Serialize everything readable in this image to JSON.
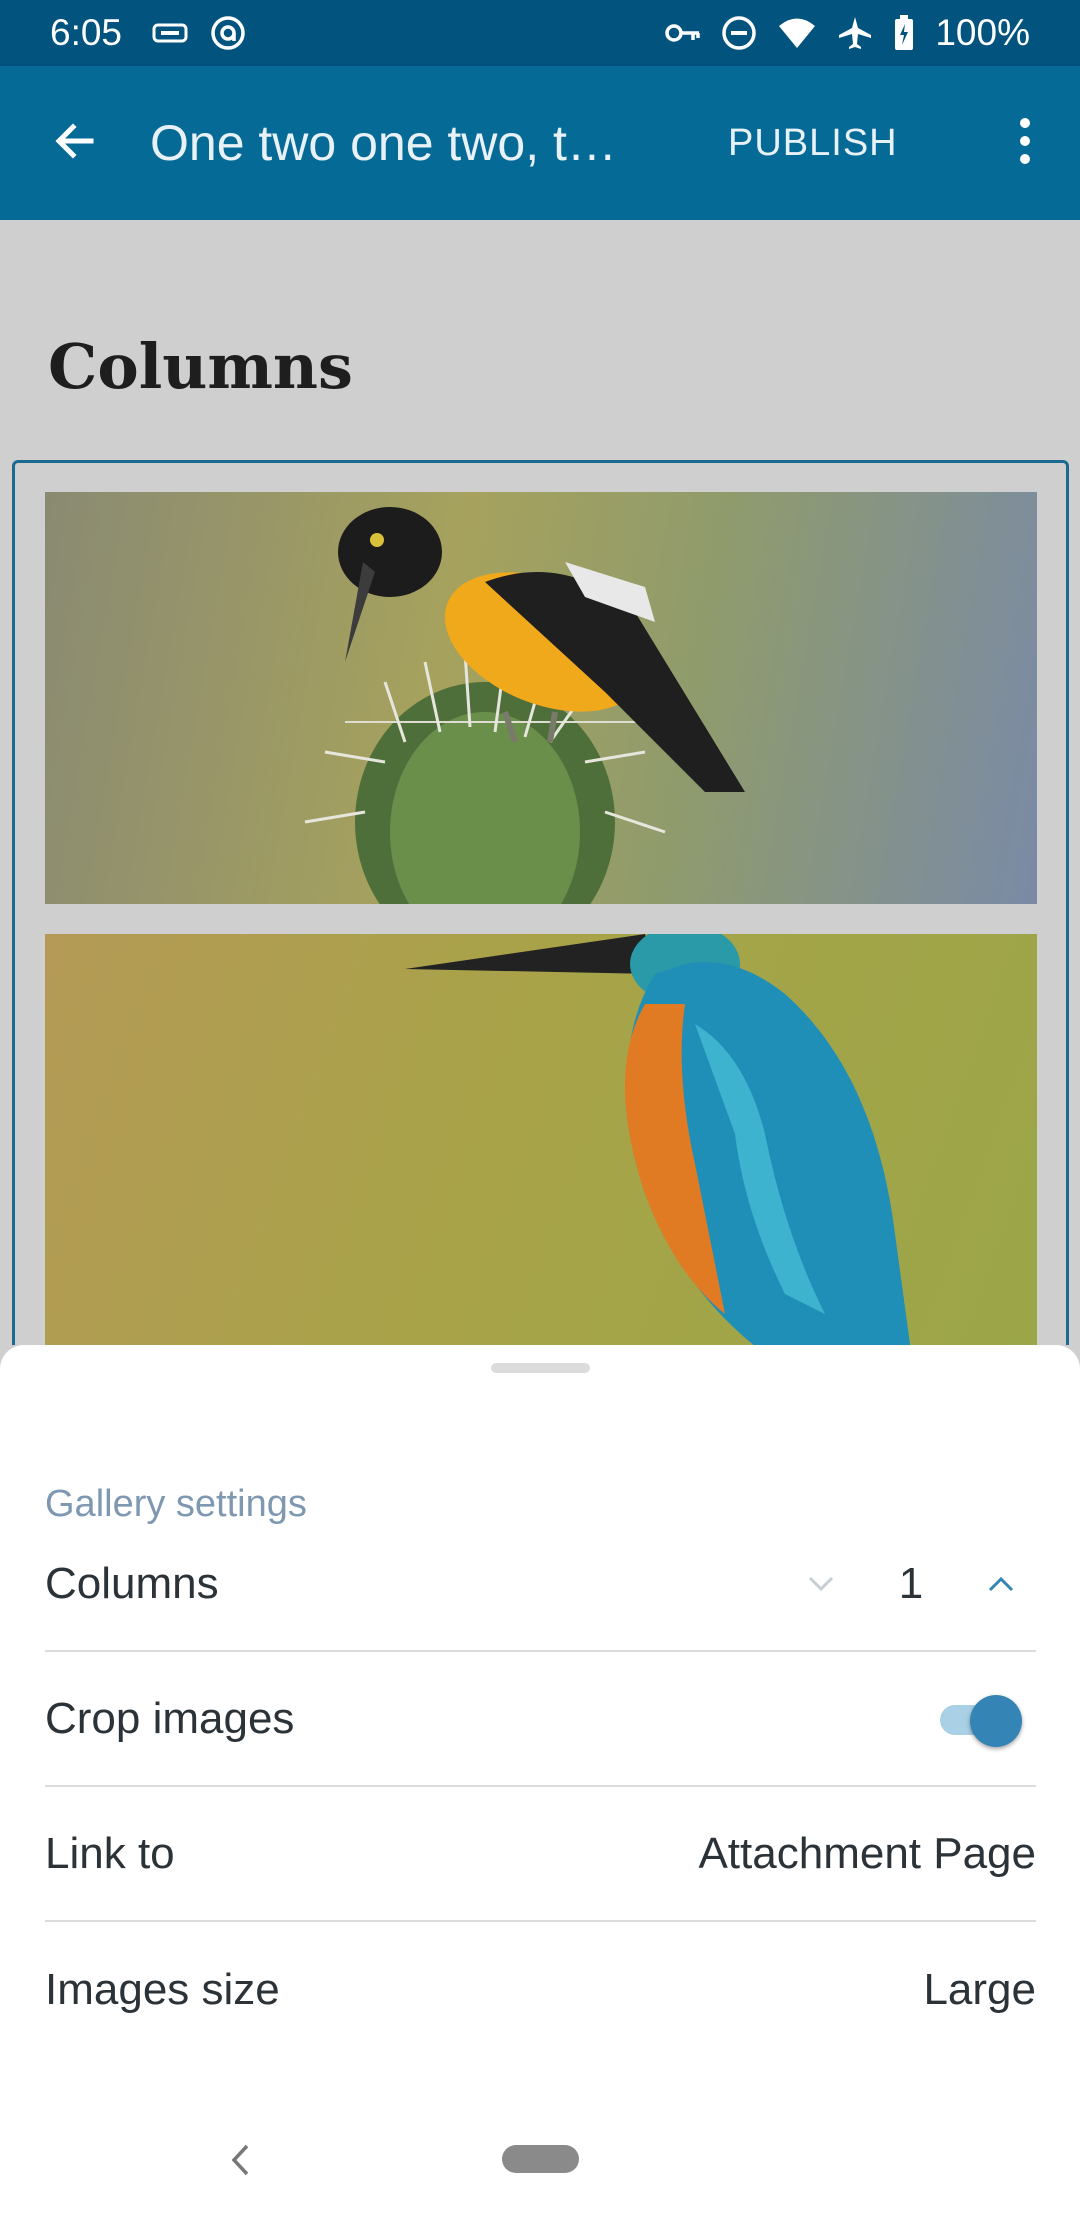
{
  "status_bar": {
    "time": "6:05",
    "battery": "100%",
    "left_icons": [
      "tag-icon",
      "at-sign-icon"
    ],
    "right_icons": [
      "vpn-key-icon",
      "do-not-disturb-icon",
      "wifi-icon",
      "airplane-icon",
      "battery-charging-icon"
    ]
  },
  "app_bar": {
    "title": "One two one two, t…",
    "publish_label": "PUBLISH",
    "back_icon": "arrow-back-icon",
    "more_icon": "more-vert-icon",
    "color": "#066a97"
  },
  "editor": {
    "heading": "Columns",
    "gallery_images": [
      {
        "name": "bird-on-cactus-image"
      },
      {
        "name": "kingfisher-image"
      }
    ]
  },
  "sheet": {
    "title": "Gallery settings",
    "columns_label": "Columns",
    "columns_value": "1",
    "crop_label": "Crop images",
    "crop_enabled": true,
    "link_label": "Link to",
    "link_value": "Attachment Page",
    "size_label": "Images size",
    "size_value": "Large",
    "accent_color": "#3584b6"
  }
}
